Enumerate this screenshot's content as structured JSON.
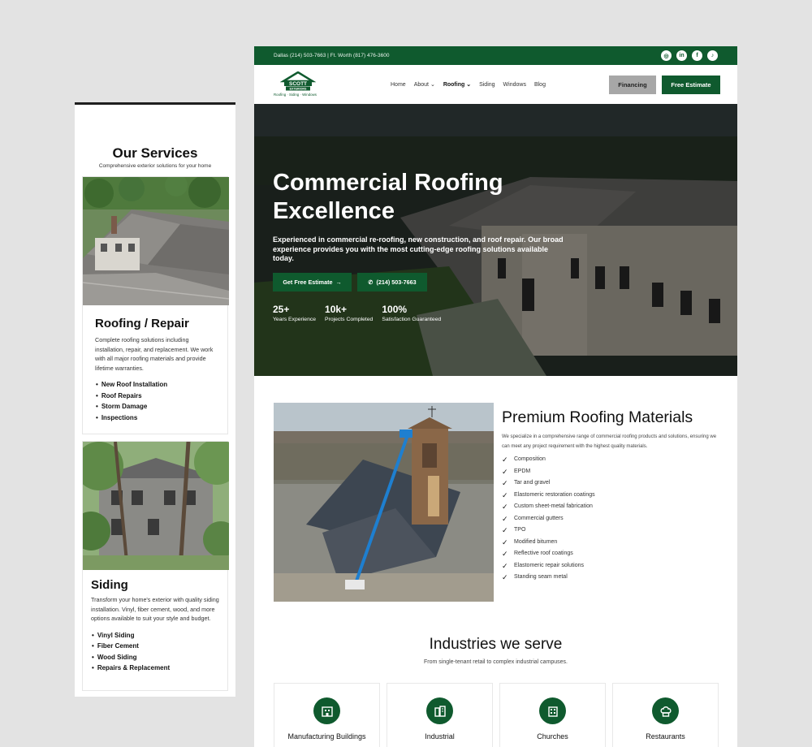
{
  "mobile": {
    "title": "Our Services",
    "subtitle": "Comprehensive exterior solutions for your home",
    "cards": [
      {
        "title": "Roofing / Repair",
        "description": "Complete roofing solutions including installation, repair, and replacement. We work with all major roofing materials and provide lifetime warranties.",
        "items": [
          "New Roof Installation",
          "Roof Repairs",
          "Storm Damage",
          "Inspections"
        ]
      },
      {
        "title": "Siding",
        "description": "Transform your home's exterior with quality siding installation. Vinyl, fiber cement, wood, and more options available to suit your style and budget.",
        "items": [
          "Vinyl Siding",
          "Fiber Cement",
          "Wood Siding",
          "Repairs & Replacement"
        ]
      }
    ]
  },
  "topbar": {
    "phones": "Dallas (214) 503-7663  |  Ft. Worth (817) 476-3600",
    "socials": [
      "instagram-icon",
      "linkedin-icon",
      "facebook-icon",
      "tiktok-icon"
    ]
  },
  "nav": {
    "logo_text": "SCOTT",
    "logo_sub": "EXTERIORS",
    "logo_tagline": "Roofing · Siding · Windows",
    "items": [
      "Home",
      "About",
      "Roofing",
      "Siding",
      "Windows",
      "Blog"
    ],
    "active": "Roofing",
    "financing": "Financing",
    "estimate": "Free Estimate"
  },
  "hero": {
    "title": "Commercial Roofing Excellence",
    "text": "Experienced in commercial re-roofing, new construction, and roof repair. Our broad experience provides you with the most cutting-edge roofing solutions available today.",
    "cta_primary": "Get Free Estimate",
    "cta_phone": "(214) 503-7663",
    "stats": [
      {
        "num": "25+",
        "label": "Years Experience"
      },
      {
        "num": "10k+",
        "label": "Projects Completed"
      },
      {
        "num": "100%",
        "label": "Satisfaction Guaranteed"
      }
    ]
  },
  "materials": {
    "title": "Premium Roofing Materials",
    "text": "We specialize in a comprehensive range of commercial roofing products and solutions, ensuring we can meet any project requirement with the highest quality materials.",
    "items": [
      "Composition",
      "EPDM",
      "Tar and gravel",
      "Elastomeric restoration coatings",
      "Custom sheet-metal fabrication",
      "Commercial gutters",
      "TPO",
      "Modified bitumen",
      "Reflective roof coatings",
      "Elastomeric repair solutions",
      "Standing seam metal"
    ]
  },
  "industries": {
    "title": "Industries we serve",
    "subtitle": "From single-tenant retail to complex industrial campuses.",
    "items": [
      {
        "label": "Manufacturing Buildings",
        "icon": "factory-icon"
      },
      {
        "label": "Industrial",
        "icon": "industrial-building-icon"
      },
      {
        "label": "Churches",
        "icon": "church-icon"
      },
      {
        "label": "Restaurants",
        "icon": "chef-hat-icon"
      }
    ]
  },
  "colors": {
    "brand_green": "#0f5a2e",
    "financing_gray": "#a7a7a7"
  }
}
